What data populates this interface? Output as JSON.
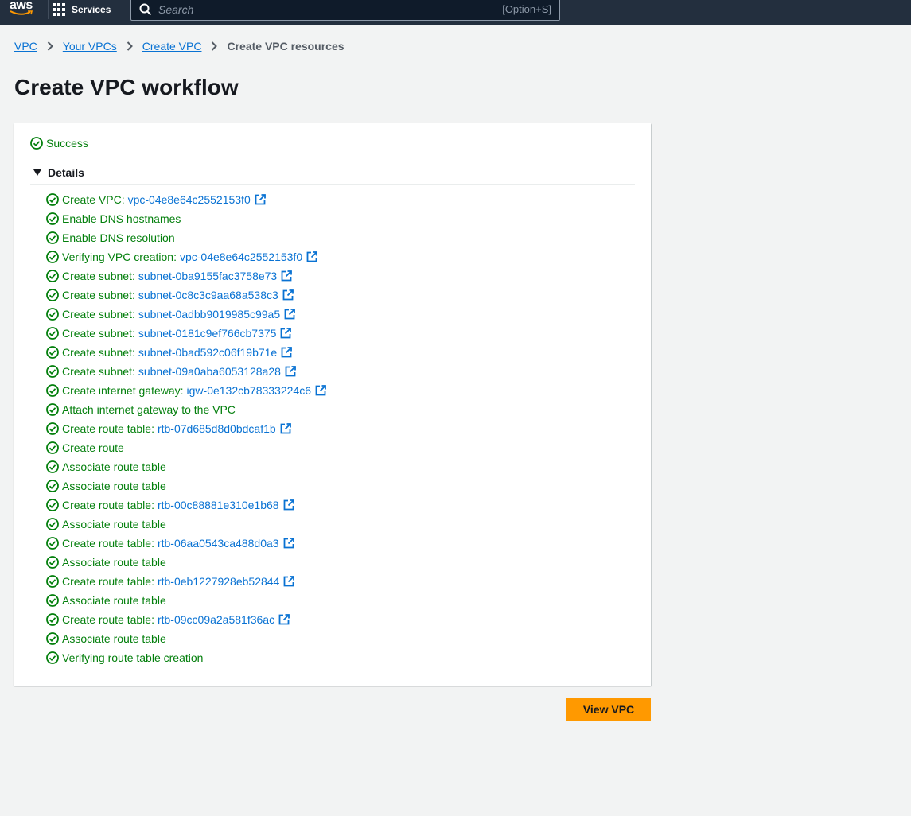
{
  "header": {
    "logo_text": "aws",
    "services_label": "Services",
    "search_placeholder": "Search",
    "search_shortcut": "[Option+S]"
  },
  "breadcrumb": {
    "items": [
      "VPC",
      "Your VPCs",
      "Create VPC"
    ],
    "current": "Create VPC resources"
  },
  "page": {
    "title": "Create VPC workflow",
    "status": "Success",
    "details_label": "Details",
    "view_button": "View VPC"
  },
  "steps": [
    {
      "text": "Create VPC:",
      "id": "vpc-04e8e64c2552153f0"
    },
    {
      "text": "Enable DNS hostnames"
    },
    {
      "text": "Enable DNS resolution"
    },
    {
      "text": "Verifying VPC creation:",
      "id": "vpc-04e8e64c2552153f0"
    },
    {
      "text": "Create subnet:",
      "id": "subnet-0ba9155fac3758e73"
    },
    {
      "text": "Create subnet:",
      "id": "subnet-0c8c3c9aa68a538c3"
    },
    {
      "text": "Create subnet:",
      "id": "subnet-0adbb9019985c99a5"
    },
    {
      "text": "Create subnet:",
      "id": "subnet-0181c9ef766cb7375"
    },
    {
      "text": "Create subnet:",
      "id": "subnet-0bad592c06f19b71e"
    },
    {
      "text": "Create subnet:",
      "id": "subnet-09a0aba6053128a28"
    },
    {
      "text": "Create internet gateway:",
      "id": "igw-0e132cb78333224c6"
    },
    {
      "text": "Attach internet gateway to the VPC"
    },
    {
      "text": "Create route table:",
      "id": "rtb-07d685d8d0bdcaf1b"
    },
    {
      "text": "Create route"
    },
    {
      "text": "Associate route table"
    },
    {
      "text": "Associate route table"
    },
    {
      "text": "Create route table:",
      "id": "rtb-00c88881e310e1b68"
    },
    {
      "text": "Associate route table"
    },
    {
      "text": "Create route table:",
      "id": "rtb-06aa0543ca488d0a3"
    },
    {
      "text": "Associate route table"
    },
    {
      "text": "Create route table:",
      "id": "rtb-0eb1227928eb52844"
    },
    {
      "text": "Associate route table"
    },
    {
      "text": "Create route table:",
      "id": "rtb-09cc09a2a581f36ac"
    },
    {
      "text": "Associate route table"
    },
    {
      "text": "Verifying route table creation"
    }
  ],
  "colors": {
    "nav_bg": "#232f3e",
    "success": "#037f0c",
    "link": "#0972d3",
    "primary_button": "#ff9900"
  }
}
